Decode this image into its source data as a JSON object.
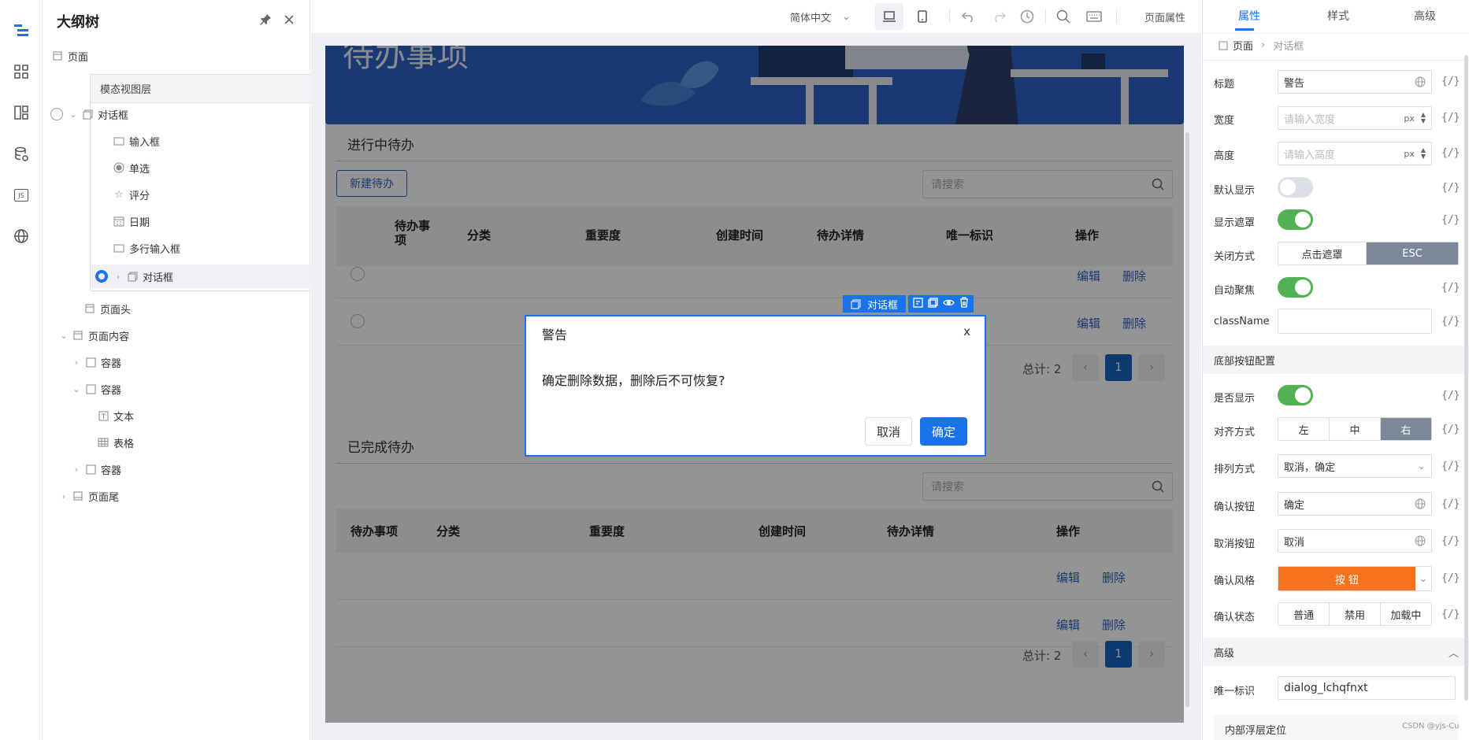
{
  "rail": {
    "icons": [
      "outline-icon",
      "components-icon",
      "layout-icon",
      "datasource-icon",
      "js-icon",
      "globe-icon"
    ],
    "js_label": "JS"
  },
  "outline": {
    "title": "大纲树",
    "root": "页面",
    "modal_layer": "模态视图层",
    "items": {
      "dialog1": "对话框",
      "input": "输入框",
      "radio": "单选",
      "rate": "评分",
      "date": "日期",
      "textarea": "多行输入框",
      "dialog2": "对话框",
      "header": "页面头",
      "content": "页面内容",
      "container1": "容器",
      "container2": "容器",
      "text": "文本",
      "table": "表格",
      "container3": "容器",
      "footer": "页面尾"
    }
  },
  "toolbar": {
    "language": "简体中文",
    "page_props": "页面属性"
  },
  "stage": {
    "banner_text": "待办事项",
    "in_progress_title": "进行中待办",
    "new_button": "新建待办",
    "search_placeholder": "请搜索",
    "table1_headers": [
      "待办事项",
      "分类",
      "重要度",
      "创建时间",
      "待办详情",
      "唯一标识",
      "操作"
    ],
    "table2_headers": [
      "待办事项",
      "分类",
      "重要度",
      "创建时间",
      "待办详情",
      "操作"
    ],
    "edit": "编辑",
    "delete": "删除",
    "total": "总计: 2",
    "page": "1",
    "completed_title": "已完成待办"
  },
  "dialog": {
    "tag": "对话框",
    "title": "警告",
    "close": "x",
    "message": "确定删除数据，删除后不可恢复?",
    "cancel": "取消",
    "ok": "确定"
  },
  "props": {
    "tabs": [
      "属性",
      "样式",
      "高级"
    ],
    "breadcrumb": [
      "页面",
      "对话框"
    ],
    "bind": "{/}",
    "title_label": "标题",
    "title_value": "警告",
    "width_label": "宽度",
    "width_placeholder": "请输入宽度",
    "height_label": "高度",
    "height_placeholder": "请输入高度",
    "unit": "px",
    "default_show_label": "默认显示",
    "default_show": false,
    "mask_label": "显示遮罩",
    "mask": true,
    "close_mode_label": "关闭方式",
    "close_modes": [
      "点击遮罩",
      "ESC"
    ],
    "autofocus_label": "自动聚焦",
    "autofocus": true,
    "classname_label": "className",
    "footer_section": "底部按钮配置",
    "show_label": "是否显示",
    "show": true,
    "align_label": "对齐方式",
    "align_options": [
      "左",
      "中",
      "右"
    ],
    "order_label": "排列方式",
    "order_value": "取消，确定",
    "ok_btn_label": "确认按钮",
    "ok_btn_value": "确定",
    "cancel_btn_label": "取消按钮",
    "cancel_btn_value": "取消",
    "ok_style_label": "确认风格",
    "ok_style_button": "按 钮",
    "ok_state_label": "确认状态",
    "ok_states": [
      "普通",
      "禁用",
      "加载中"
    ],
    "advanced_section": "高级",
    "id_label": "唯一标识",
    "id_value": "dialog_lchqfnxt",
    "float_label": "内部浮层定位",
    "watermark": "CSDN @yjs-Cu",
    "colors": {
      "accent": "#1a73e8",
      "switch_on": "#52b153",
      "orange": "#f5721e",
      "seg_on": "#7b8899"
    }
  }
}
